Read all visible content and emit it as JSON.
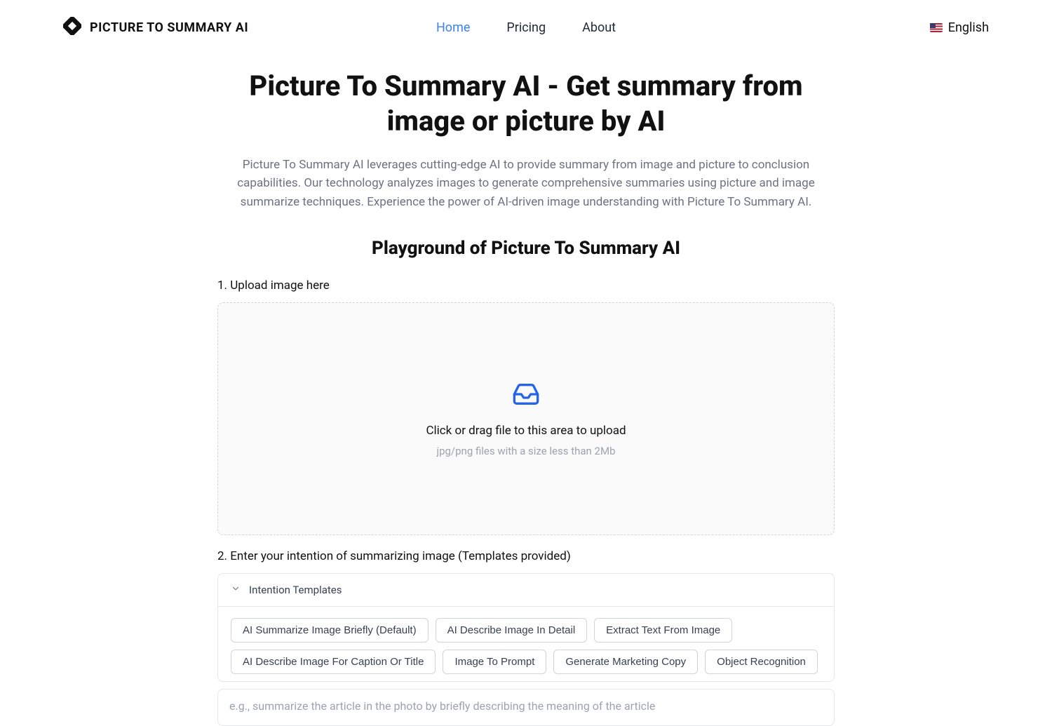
{
  "brand": {
    "name": "PICTURE TO SUMMARY AI"
  },
  "nav": {
    "items": [
      {
        "label": "Home",
        "active": true
      },
      {
        "label": "Pricing",
        "active": false
      },
      {
        "label": "About",
        "active": false
      }
    ]
  },
  "lang": {
    "label": "English",
    "iconName": "flag-us-icon"
  },
  "hero": {
    "title": "Picture To Summary AI - Get summary from image or picture by AI",
    "description": "Picture To Summary AI leverages cutting-edge AI to provide summary from image and picture to conclusion capabilities. Our technology analyzes images to generate comprehensive summaries using picture and image summarize techniques. Experience the power of AI-driven image understanding with Picture To Summary AI."
  },
  "playground": {
    "title": "Playground of Picture To Summary AI",
    "step1_label": "1. Upload image here",
    "dropzone": {
      "text": "Click or drag file to this area to upload",
      "hint": "jpg/png files with a size less than 2Mb"
    },
    "step2_label": "2. Enter your intention of summarizing image (Templates provided)",
    "templates": {
      "header": "Intention Templates",
      "items": [
        "AI Summarize Image Briefly (Default)",
        "AI Describe Image In Detail",
        "Extract Text From Image",
        "AI Describe Image For Caption Or Title",
        "Image To Prompt",
        "Generate Marketing Copy",
        "Object Recognition"
      ]
    },
    "intention_input": {
      "placeholder": "e.g., summarize the article in the photo by briefly describing the meaning of the article",
      "value": ""
    }
  },
  "colors": {
    "accent": "#3b82f6"
  }
}
